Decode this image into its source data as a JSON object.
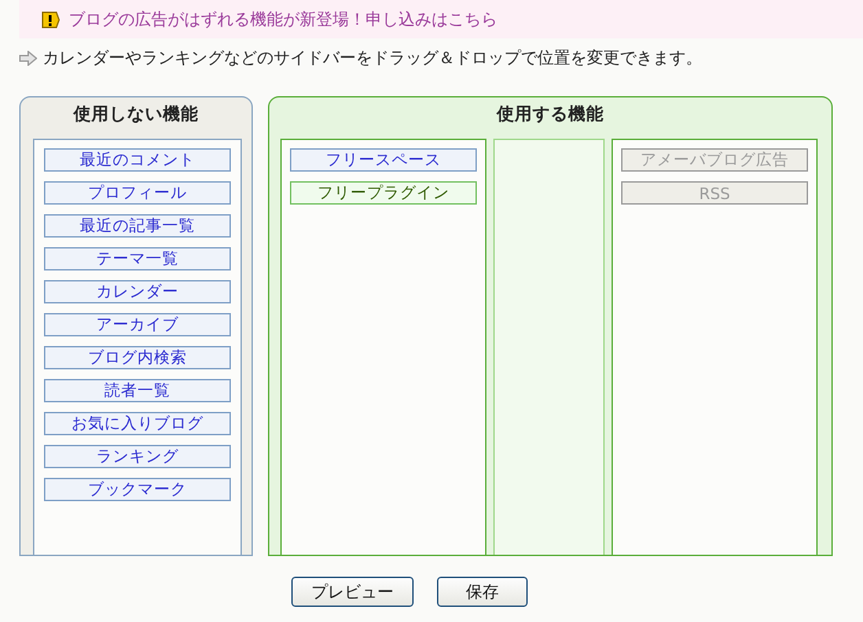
{
  "notice": {
    "text": "ブログの広告がはずれる機能が新登場！申し込みはこちら"
  },
  "instruction": "カレンダーやランキングなどのサイドバーをドラッグ＆ドロップで位置を変更できます。",
  "unused_panel": {
    "title": "使用しない機能",
    "items": [
      {
        "label": "最近のコメント",
        "kind": "widget"
      },
      {
        "label": "プロフィール",
        "kind": "widget"
      },
      {
        "label": "最近の記事一覧",
        "kind": "widget"
      },
      {
        "label": "テーマ一覧",
        "kind": "widget"
      },
      {
        "label": "カレンダー",
        "kind": "widget"
      },
      {
        "label": "アーカイブ",
        "kind": "widget"
      },
      {
        "label": "ブログ内検索",
        "kind": "widget"
      },
      {
        "label": "読者一覧",
        "kind": "widget"
      },
      {
        "label": "お気に入りブログ",
        "kind": "widget"
      },
      {
        "label": "ランキング",
        "kind": "widget"
      },
      {
        "label": "ブックマーク",
        "kind": "widget"
      }
    ]
  },
  "used_panel": {
    "title": "使用する機能",
    "columns": [
      {
        "kind": "side",
        "items": [
          {
            "label": "フリースペース",
            "kind": "widget"
          },
          {
            "label": "フリープラグイン",
            "kind": "plugin"
          }
        ]
      },
      {
        "kind": "middle"
      },
      {
        "kind": "side",
        "items": [
          {
            "label": "アメーバブログ広告",
            "kind": "fixed"
          },
          {
            "label": "RSS",
            "kind": "fixed"
          }
        ]
      }
    ]
  },
  "buttons": [
    "プレビュー",
    "保存"
  ]
}
